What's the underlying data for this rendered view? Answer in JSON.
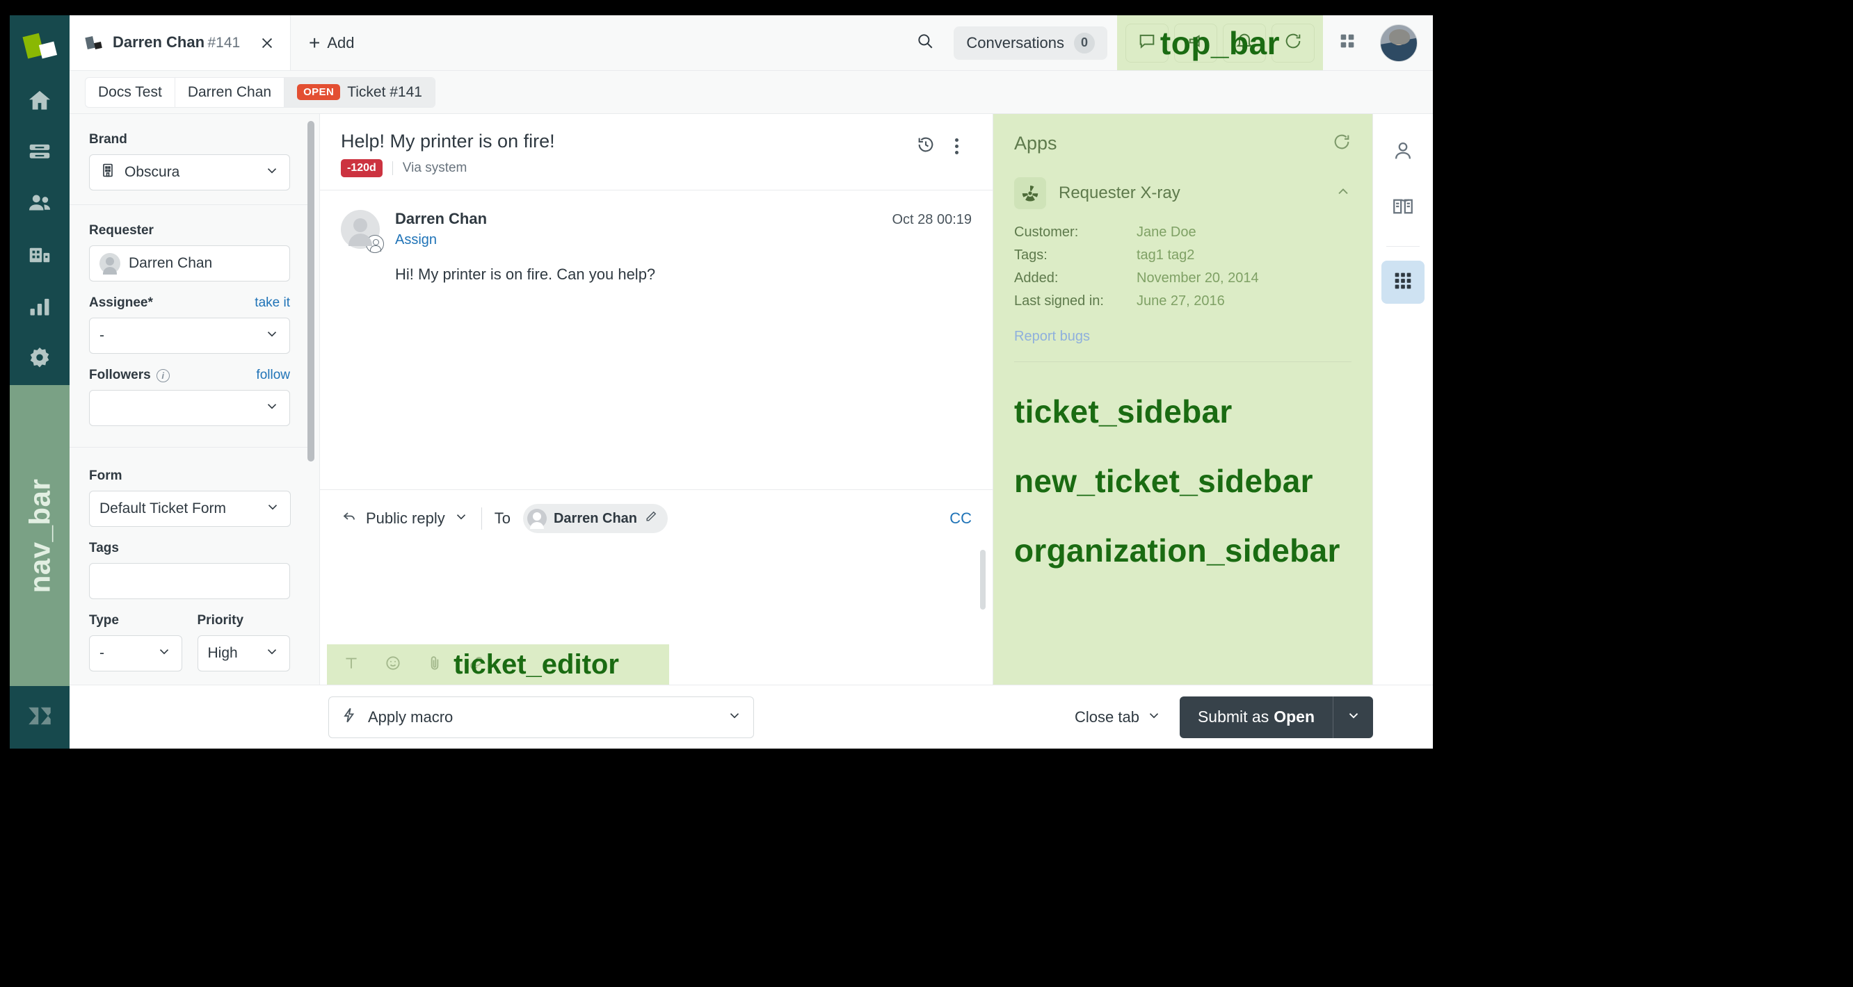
{
  "nav_bar": {
    "annotation_label": "nav_bar",
    "logo_icon": "zendesk-logo-icon",
    "items": [
      {
        "icon": "home-icon",
        "name": "home"
      },
      {
        "icon": "views-icon",
        "name": "views"
      },
      {
        "icon": "customers-icon",
        "name": "customers"
      },
      {
        "icon": "organizations-icon",
        "name": "organizations"
      },
      {
        "icon": "reporting-icon",
        "name": "reporting"
      },
      {
        "icon": "gear-icon",
        "name": "admin"
      }
    ],
    "bottom_icon": "zendesk-z-icon"
  },
  "top_bar": {
    "annotation_label": "top_bar",
    "ticket_tab": {
      "title": "Darren Chan",
      "subtitle": "#141",
      "icon": "ticket-icon",
      "close_icon": "close-icon"
    },
    "add_tab": {
      "label": "Add",
      "plus": "+"
    },
    "search_icon": "search-icon",
    "conversations": {
      "label": "Conversations",
      "count": "0"
    },
    "icons": [
      "chat-icon",
      "megaphone-icon",
      "bell-icon",
      "updates-icon"
    ],
    "apps_grid_icon": "apps-grid-icon",
    "avatar": "user-avatar"
  },
  "breadcrumb": {
    "items": [
      {
        "label": "Docs Test"
      },
      {
        "label": "Darren Chan"
      }
    ],
    "current": {
      "status_badge": "OPEN",
      "label": "Ticket #141"
    }
  },
  "ticket_sidebar": {
    "brand": {
      "label": "Brand",
      "value": "Obscura",
      "icon": "building-icon"
    },
    "requester": {
      "label": "Requester",
      "value": "Darren Chan",
      "icon": "user-avatar-icon"
    },
    "assignee": {
      "label": "Assignee*",
      "action": "take it",
      "value": "-"
    },
    "followers": {
      "label": "Followers",
      "info_icon": "info-icon",
      "action": "follow",
      "value": ""
    },
    "form": {
      "label": "Form",
      "value": "Default Ticket Form"
    },
    "tags": {
      "label": "Tags",
      "value": "",
      "placeholder": ""
    },
    "type": {
      "label": "Type",
      "value": "-"
    },
    "priority": {
      "label": "Priority",
      "value": "High"
    }
  },
  "conversation": {
    "subject": "Help! My printer is on fire!",
    "sla_badge": "-120d",
    "via": "Via system",
    "history_icon": "history-icon",
    "more_icon": "more-options-icon",
    "comments": [
      {
        "author": "Darren Chan",
        "assign_link": "Assign",
        "timestamp": "Oct 28 00:19",
        "text": "Hi! My printer is on fire. Can you help?"
      }
    ]
  },
  "ticket_editor": {
    "annotation_label": "ticket_editor",
    "channel": "Public reply",
    "to_label": "To",
    "to_recipient": "Darren Chan",
    "edit_icon": "pencil-icon",
    "cc_label": "CC",
    "toolbar_icons": [
      "text-format-icon",
      "emoji-icon",
      "attachment-icon",
      "link-icon"
    ]
  },
  "apps_panel": {
    "title": "Apps",
    "refresh_icon": "refresh-icon",
    "app": {
      "name": "Requester X-ray",
      "icon": "radiation-icon",
      "collapse_icon": "chevron-up-icon",
      "rows": [
        {
          "key": "Customer:",
          "value": "Jane Doe"
        },
        {
          "key": "Tags:",
          "value": "tag1 tag2"
        },
        {
          "key": "Added:",
          "value": "November 20, 2014"
        },
        {
          "key": "Last signed in:",
          "value": "June 27, 2016"
        }
      ],
      "link": "Report bugs"
    },
    "annotations": [
      "ticket_sidebar",
      "new_ticket_sidebar",
      "organization_sidebar"
    ]
  },
  "right_rail": {
    "items": [
      {
        "icon": "user-icon",
        "name": "user-panel",
        "active": false
      },
      {
        "icon": "knowledge-book-icon",
        "name": "knowledge-panel",
        "active": false
      },
      {
        "icon": "apps-grid-icon",
        "name": "apps-panel",
        "active": true
      }
    ]
  },
  "footer": {
    "macro": {
      "label": "Apply macro",
      "icon": "lightning-bolt-icon"
    },
    "close_tab": {
      "label": "Close tab"
    },
    "submit": {
      "prefix": "Submit as",
      "status": "Open"
    }
  },
  "colors": {
    "nav_bg": "#17494d",
    "annotation_bg": "#dcecc6",
    "annotation_text": "#1a6b12",
    "status_open": "#e34f32",
    "sla_red": "#cc3340",
    "link_blue": "#1f73b7",
    "submit_dark": "#37424a"
  }
}
